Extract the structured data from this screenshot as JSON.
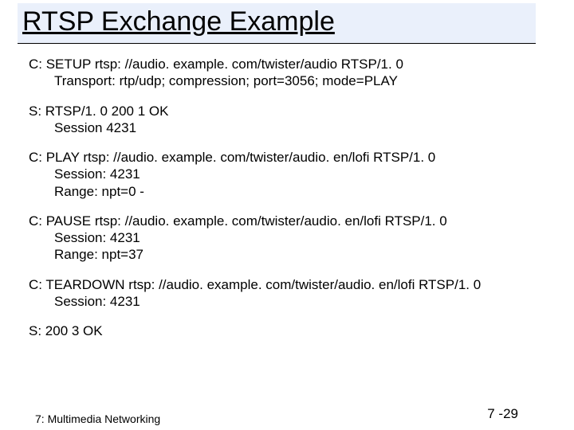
{
  "title": "RTSP Exchange Example",
  "blocks": [
    {
      "line1": "C: SETUP rtsp: //audio. example. com/twister/audio RTSP/1. 0",
      "line2": "Transport: rtp/udp; compression; port=3056; mode=PLAY"
    },
    {
      "line1": "S: RTSP/1. 0 200 1 OK",
      "line2": "Session 4231"
    },
    {
      "line1": "C: PLAY rtsp: //audio. example. com/twister/audio. en/lofi RTSP/1. 0",
      "line2": "Session: 4231",
      "line3": "Range: npt=0 -"
    },
    {
      "line1": "C: PAUSE rtsp: //audio. example. com/twister/audio. en/lofi RTSP/1. 0",
      "line2": "Session: 4231",
      "line3": "Range: npt=37"
    },
    {
      "line1": "C: TEARDOWN rtsp: //audio. example. com/twister/audio. en/lofi RTSP/1. 0",
      "line2": "Session: 4231"
    },
    {
      "line1": "S: 200 3 OK"
    }
  ],
  "footer": {
    "left": "7: Multimedia Networking",
    "right": "7 -29"
  }
}
